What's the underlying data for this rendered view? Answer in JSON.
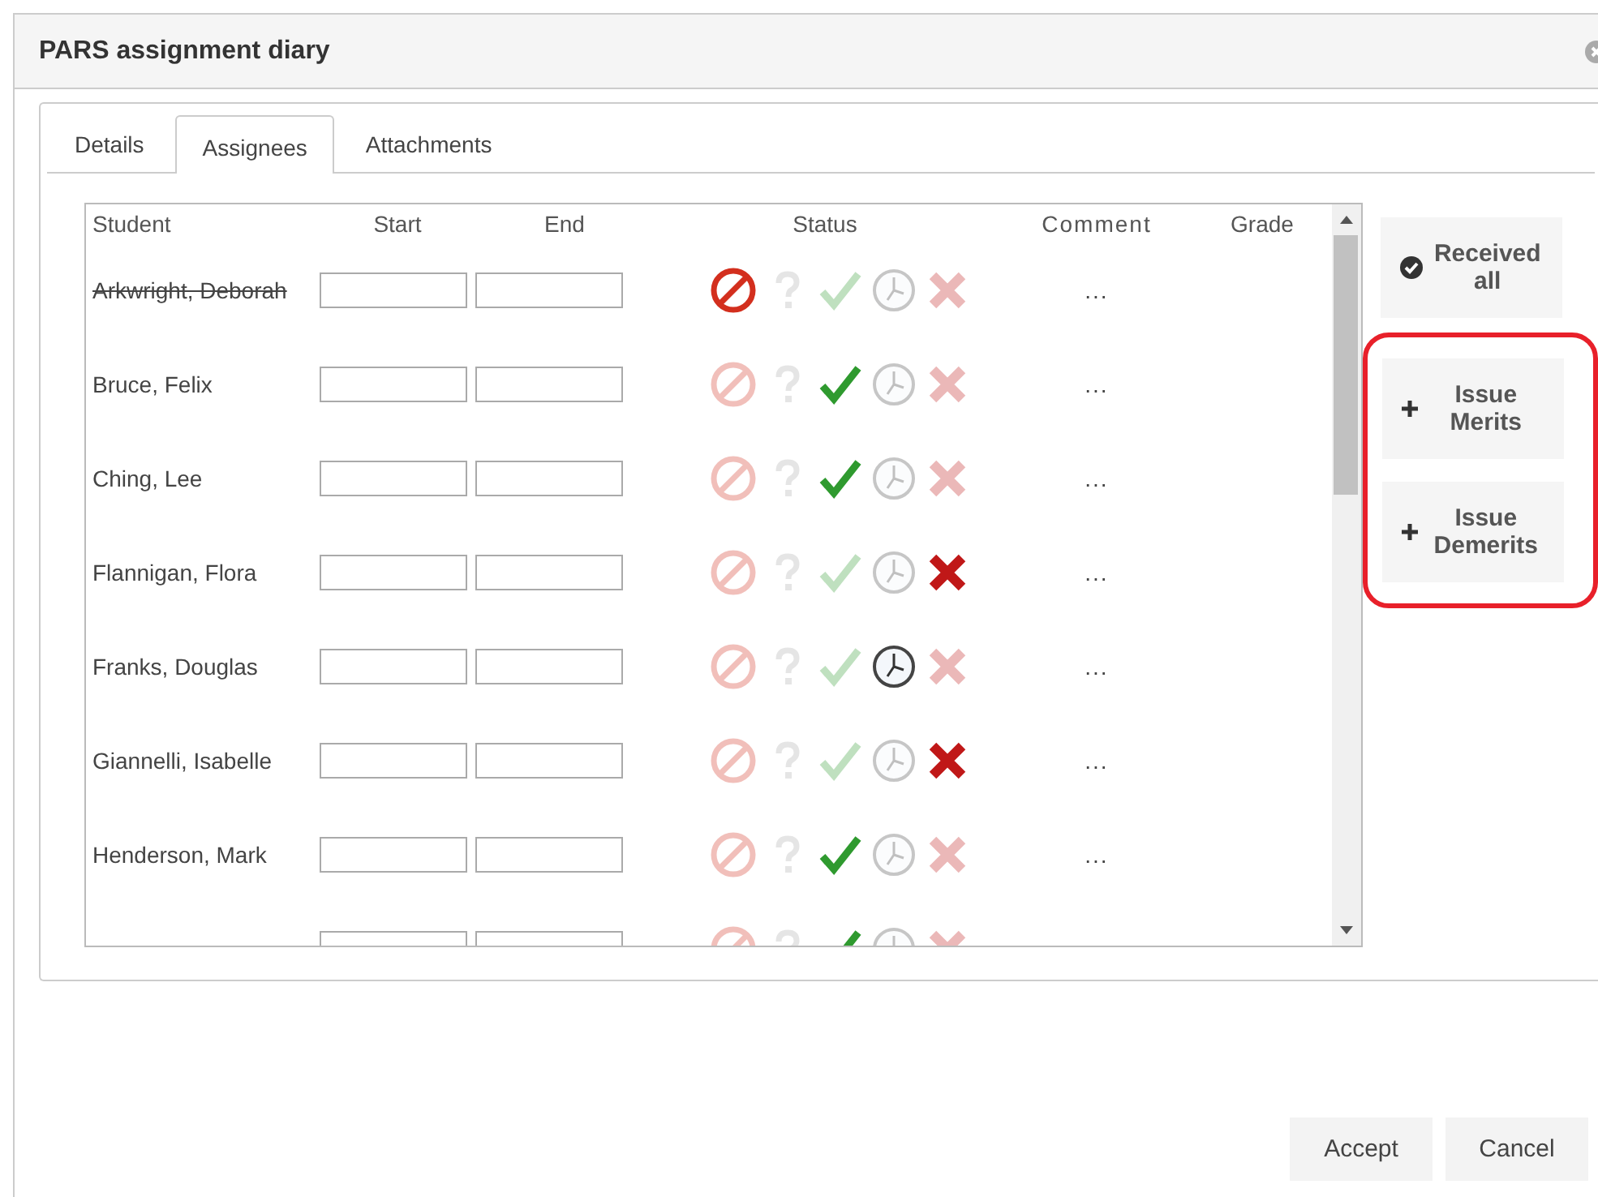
{
  "window": {
    "title": "PARS assignment diary"
  },
  "tabs": [
    {
      "label": "Details",
      "selected": false
    },
    {
      "label": "Assignees",
      "selected": true
    },
    {
      "label": "Attachments",
      "selected": false
    }
  ],
  "table": {
    "columns": [
      "Student",
      "Start",
      "End",
      "Status",
      "Comment",
      "Grade"
    ],
    "rows": [
      {
        "student": "Arkwright, Deborah",
        "withdrawn": true,
        "comment": "...",
        "status": [
          {
            "kind": "excused",
            "on": true
          },
          {
            "kind": "unknown",
            "on": false
          },
          {
            "kind": "received",
            "on": false
          },
          {
            "kind": "late",
            "on": false
          },
          {
            "kind": "missing",
            "on": false
          }
        ]
      },
      {
        "student": "Bruce, Felix",
        "withdrawn": false,
        "comment": "...",
        "status": [
          {
            "kind": "excused",
            "on": false
          },
          {
            "kind": "unknown",
            "on": false
          },
          {
            "kind": "received",
            "on": true
          },
          {
            "kind": "late",
            "on": false
          },
          {
            "kind": "missing",
            "on": false
          }
        ]
      },
      {
        "student": "Ching, Lee",
        "withdrawn": false,
        "comment": "...",
        "status": [
          {
            "kind": "excused",
            "on": false
          },
          {
            "kind": "unknown",
            "on": false
          },
          {
            "kind": "received",
            "on": true
          },
          {
            "kind": "late",
            "on": false
          },
          {
            "kind": "missing",
            "on": false
          }
        ]
      },
      {
        "student": "Flannigan, Flora",
        "withdrawn": false,
        "comment": "...",
        "status": [
          {
            "kind": "excused",
            "on": false
          },
          {
            "kind": "unknown",
            "on": false
          },
          {
            "kind": "received",
            "on": false
          },
          {
            "kind": "late",
            "on": false
          },
          {
            "kind": "missing",
            "on": true
          }
        ]
      },
      {
        "student": "Franks, Douglas",
        "withdrawn": false,
        "comment": "...",
        "status": [
          {
            "kind": "excused",
            "on": false
          },
          {
            "kind": "unknown",
            "on": false
          },
          {
            "kind": "received",
            "on": false
          },
          {
            "kind": "late",
            "on": true
          },
          {
            "kind": "missing",
            "on": false
          }
        ]
      },
      {
        "student": "Giannelli, Isabelle",
        "withdrawn": false,
        "comment": "...",
        "status": [
          {
            "kind": "excused",
            "on": false
          },
          {
            "kind": "unknown",
            "on": false
          },
          {
            "kind": "received",
            "on": false
          },
          {
            "kind": "late",
            "on": false
          },
          {
            "kind": "missing",
            "on": true
          }
        ]
      },
      {
        "student": "Henderson, Mark",
        "withdrawn": false,
        "comment": "...",
        "status": [
          {
            "kind": "excused",
            "on": false
          },
          {
            "kind": "unknown",
            "on": false
          },
          {
            "kind": "received",
            "on": true
          },
          {
            "kind": "late",
            "on": false
          },
          {
            "kind": "missing",
            "on": false
          }
        ]
      },
      {
        "status": [
          {
            "kind": "excused",
            "on": false
          },
          {
            "kind": "unknown",
            "on": false
          },
          {
            "kind": "received",
            "on": true
          },
          {
            "kind": "late",
            "on": false
          },
          {
            "kind": "missing",
            "on": false
          }
        ]
      }
    ]
  },
  "side_buttons": [
    {
      "label": "Received all",
      "kind": "check",
      "highlighted": false
    },
    {
      "label": "Issue Merits",
      "kind": "plus",
      "highlighted": true
    },
    {
      "label": "Issue Demerits",
      "kind": "plus",
      "highlighted": true
    }
  ],
  "footer_buttons": [
    "Accept",
    "Cancel"
  ]
}
